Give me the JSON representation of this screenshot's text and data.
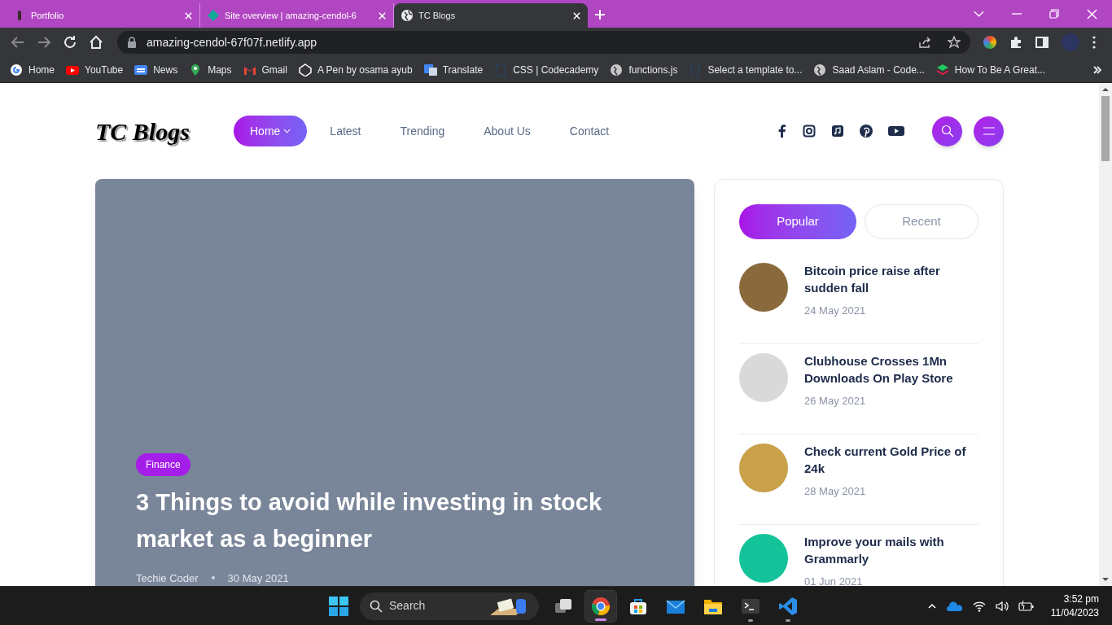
{
  "browser": {
    "tabs": [
      {
        "title": "Portfolio",
        "selected": false
      },
      {
        "title": "Site overview | amazing-cendol-6",
        "selected": false
      },
      {
        "title": "TC Blogs",
        "selected": true
      }
    ],
    "address": "amazing-cendol-67f07f.netlify.app",
    "bookmarks": [
      {
        "label": "Home",
        "kind": "google"
      },
      {
        "label": "YouTube",
        "kind": "youtube"
      },
      {
        "label": "News",
        "kind": "news"
      },
      {
        "label": "Maps",
        "kind": "maps"
      },
      {
        "label": "Gmail",
        "kind": "gmail"
      },
      {
        "label": "A Pen by osama ayub",
        "kind": "codepen"
      },
      {
        "label": "Translate",
        "kind": "translate"
      },
      {
        "label": "CSS | Codecademy",
        "kind": "page"
      },
      {
        "label": "functions.js",
        "kind": "globe"
      },
      {
        "label": "Select a template to...",
        "kind": "page"
      },
      {
        "label": "Saad Aslam - Code...",
        "kind": "globe"
      },
      {
        "label": "How To Be A Great...",
        "kind": "layers"
      }
    ]
  },
  "site": {
    "logo": "TC Blogs",
    "nav": [
      {
        "label": "Home",
        "selected": true
      },
      {
        "label": "Latest",
        "selected": false
      },
      {
        "label": "Trending",
        "selected": false
      },
      {
        "label": "About Us",
        "selected": false
      },
      {
        "label": "Contact",
        "selected": false
      }
    ],
    "hero": {
      "category": "Finance",
      "title": "3 Things to avoid while investing in stock market as a beginner",
      "author": "Techie Coder",
      "date": "30 May 2021"
    },
    "sidebar": {
      "tabs": [
        {
          "label": "Popular",
          "selected": true
        },
        {
          "label": "Recent",
          "selected": false
        }
      ],
      "posts": [
        {
          "title": "Bitcoin price raise after sudden fall",
          "date": "24 May 2021",
          "color": "#8a6a3c"
        },
        {
          "title": "Clubhouse Crosses 1Mn Downloads On Play Store",
          "date": "26 May 2021",
          "color": "#d9d9d9"
        },
        {
          "title": "Check current Gold Price of 24k",
          "date": "28 May 2021",
          "color": "#c9a14a"
        },
        {
          "title": "Improve your mails with Grammarly",
          "date": "01 Jun 2021",
          "color": "#15c39a"
        }
      ]
    }
  },
  "taskbar": {
    "search": {
      "placeholder": "Search"
    },
    "apps": [
      {
        "kind": "taskview",
        "active": false,
        "running": false
      },
      {
        "kind": "chrome",
        "active": true,
        "running": true
      },
      {
        "kind": "store",
        "active": false,
        "running": false
      },
      {
        "kind": "mail",
        "active": false,
        "running": false
      },
      {
        "kind": "files",
        "active": false,
        "running": false
      },
      {
        "kind": "terminal",
        "active": false,
        "running": true
      },
      {
        "kind": "vscode",
        "active": false,
        "running": true
      }
    ],
    "time": "3:52 pm",
    "date": "11/04/2023"
  }
}
